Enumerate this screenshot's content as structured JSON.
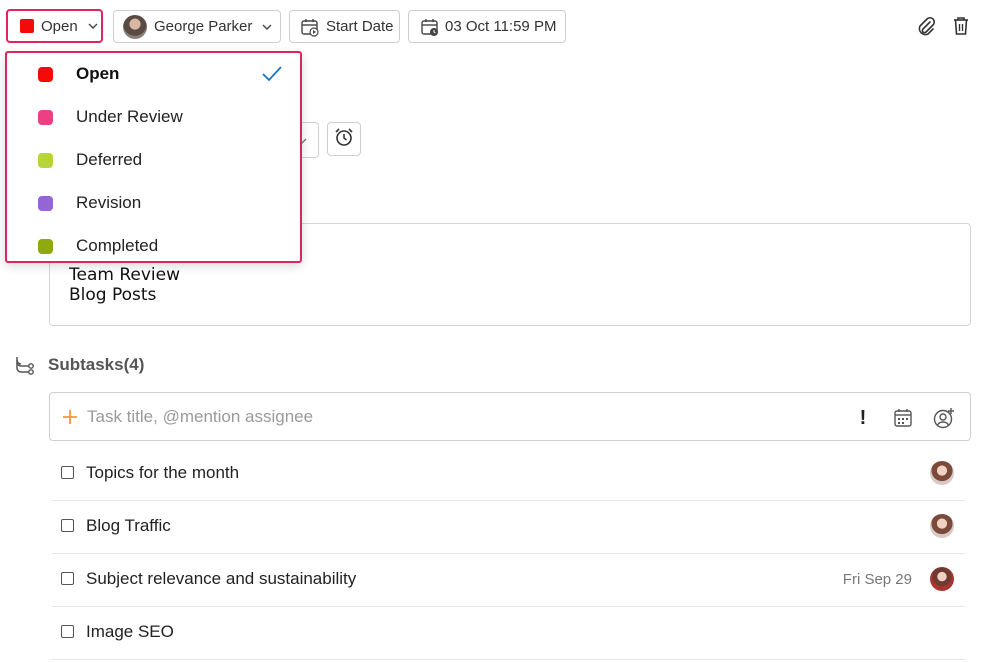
{
  "toolbar": {
    "status_label": "Open",
    "status_color": "#f50a0a",
    "assignee_name": "George Parker",
    "start_date_label": "Start Date",
    "due_date_label": "03 Oct 11:59 PM",
    "icons": [
      "chevron-down-icon",
      "calendar-start-icon",
      "calendar-due-icon",
      "paperclip-icon",
      "trash-icon"
    ]
  },
  "status_dropdown": {
    "options": [
      {
        "label": "Open",
        "color": "#f50a0a",
        "selected": true
      },
      {
        "label": "Under Review",
        "color": "#ec3f84",
        "selected": false
      },
      {
        "label": "Deferred",
        "color": "#b7d43a",
        "selected": false
      },
      {
        "label": "Revision",
        "color": "#9466d4",
        "selected": false
      },
      {
        "label": "Completed",
        "color": "#8faa0f",
        "selected": false
      }
    ],
    "accent": "#1a73c8"
  },
  "description": {
    "lines": [
      "Team Review",
      "Blog Posts"
    ]
  },
  "subtasks": {
    "title": "Subtasks(4)",
    "input_placeholder": "Task title, @mention assignee",
    "priority_symbol": "!",
    "items": [
      {
        "title": "Topics for the month",
        "date": ""
      },
      {
        "title": "Blog Traffic",
        "date": ""
      },
      {
        "title": "Subject relevance and sustainability",
        "date": "Fri Sep 29"
      },
      {
        "title": "Image SEO",
        "date": ""
      }
    ]
  }
}
